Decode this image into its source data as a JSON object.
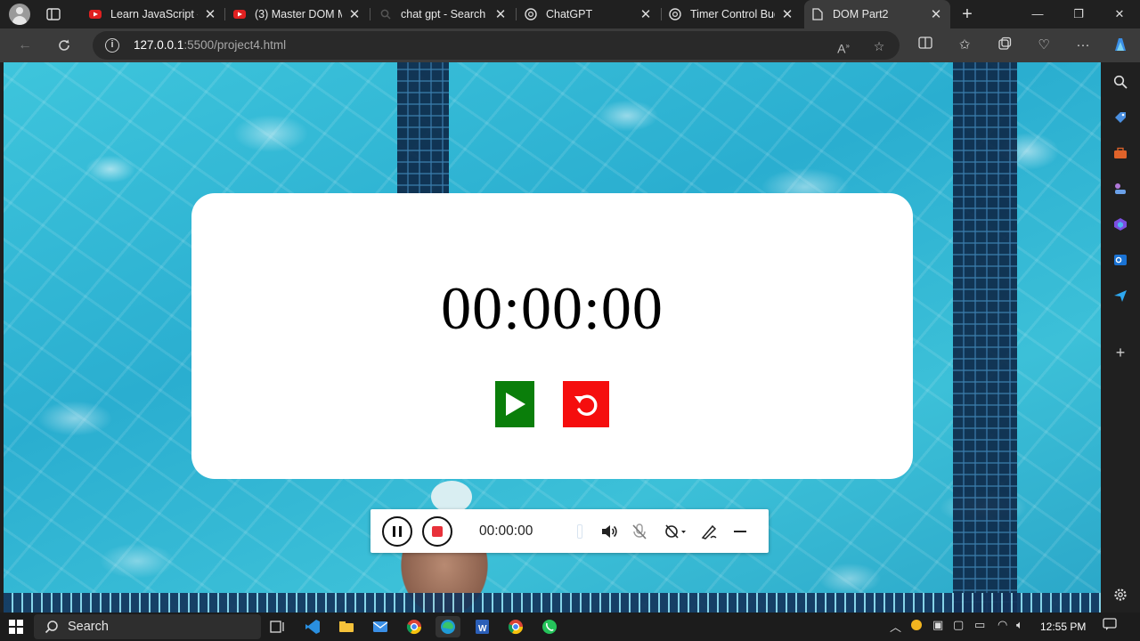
{
  "browser": {
    "tabs": [
      {
        "title": "Learn JavaScript - ",
        "icon": "youtube-icon",
        "active": false
      },
      {
        "title": "(3) Master DOM M",
        "icon": "youtube-icon",
        "active": false
      },
      {
        "title": "chat gpt - Search",
        "icon": "search-icon",
        "active": false
      },
      {
        "title": "ChatGPT",
        "icon": "chatgpt-icon",
        "active": false
      },
      {
        "title": "Timer Control Bug",
        "icon": "chatgpt-icon",
        "active": false
      },
      {
        "title": "DOM Part2",
        "icon": "page-icon",
        "active": true
      }
    ],
    "address": {
      "host": "127.0.0.1",
      "rest": ":5500/project4.html"
    }
  },
  "page": {
    "timer_display": "00:00:00",
    "start_button_color": "#0a7e0a",
    "reset_button_color": "#f50e0e"
  },
  "recording_toolbar": {
    "elapsed": "00:00:00"
  },
  "taskbar": {
    "search_label": "Search",
    "time": "12:55 PM"
  }
}
